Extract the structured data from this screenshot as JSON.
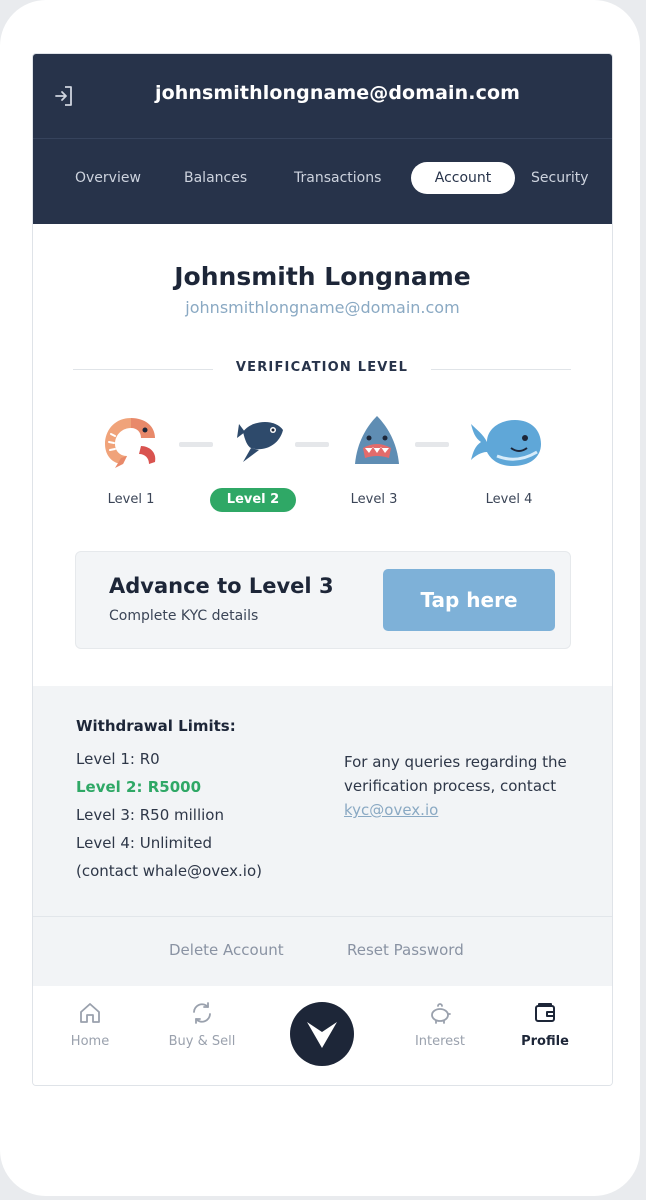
{
  "header": {
    "email": "johnsmithlongname@domain.com",
    "tabs": [
      {
        "label": "Overview"
      },
      {
        "label": "Balances"
      },
      {
        "label": "Transactions"
      },
      {
        "label": "Account"
      },
      {
        "label": "Security"
      }
    ],
    "active_tab": "Account"
  },
  "profile": {
    "name": "Johnsmith Longname",
    "email": "johnsmithlongname@domain.com"
  },
  "verification": {
    "heading": "VERIFICATION LEVEL",
    "levels": [
      {
        "label": "Level 1",
        "icon": "shrimp-icon"
      },
      {
        "label": "Level 2",
        "icon": "fish-icon"
      },
      {
        "label": "Level 3",
        "icon": "shark-icon"
      },
      {
        "label": "Level 4",
        "icon": "whale-icon"
      }
    ],
    "current_level": "Level 2"
  },
  "advance": {
    "title": "Advance to Level 3",
    "subtitle": "Complete KYC details",
    "button": "Tap here"
  },
  "limits": {
    "title": "Withdrawal Limits:",
    "lines": [
      "Level 1: R0",
      "Level 2: R5000",
      "Level 3: R50 million",
      "Level 4: Unlimited",
      "(contact whale@ovex.io)"
    ],
    "queries_text": "For any queries regarding the verification process, contact",
    "queries_link": "kyc@ovex.io"
  },
  "footer": {
    "delete": "Delete Account",
    "reset": "Reset Password"
  },
  "nav": {
    "items": [
      {
        "label": "Home",
        "icon": "home-icon"
      },
      {
        "label": "Buy & Sell",
        "icon": "refresh-icon"
      },
      {
        "label": "",
        "icon": "ovex-logo-icon"
      },
      {
        "label": "Interest",
        "icon": "piggy-bank-icon"
      },
      {
        "label": "Profile",
        "icon": "wallet-icon"
      }
    ],
    "active": "Profile"
  },
  "colors": {
    "header_bg": "#27334a",
    "accent_green": "#2fa866",
    "button_blue": "#7eb1d8",
    "link_blue": "#8aa9c3"
  }
}
